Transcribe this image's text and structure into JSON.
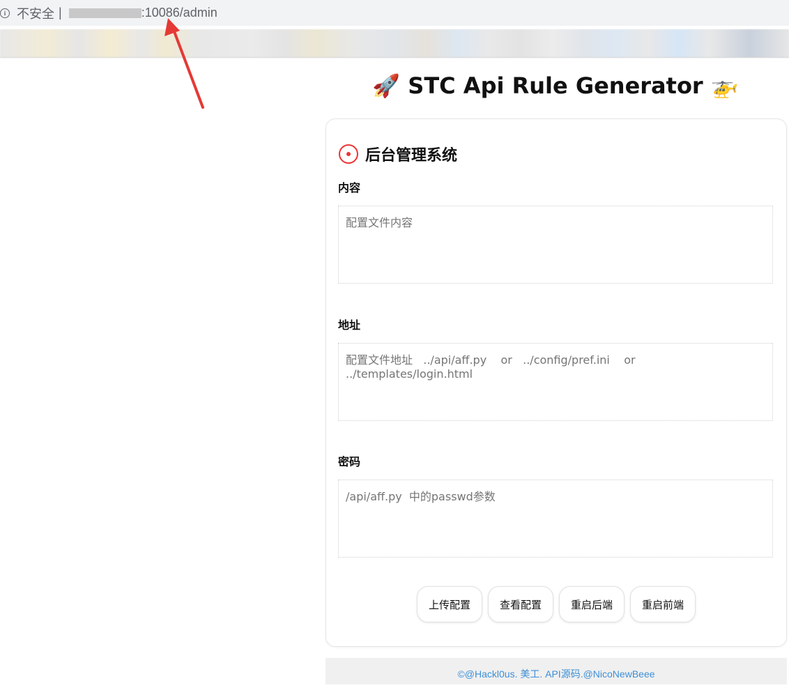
{
  "browser": {
    "security_label": "不安全",
    "separator": "|",
    "url_path": ":10086/admin"
  },
  "page": {
    "title": "🚀 STC Api Rule Generator 🚁"
  },
  "admin": {
    "title": "后台管理系统",
    "fields": [
      {
        "label": "内容",
        "placeholder": "配置文件内容"
      },
      {
        "label": "地址",
        "placeholder": "配置文件地址   ../api/aff.py    or   ../config/pref.ini    or  ../templates/login.html"
      },
      {
        "label": "密码",
        "placeholder": "/api/aff.py  中的passwd参数"
      }
    ],
    "buttons": [
      "上传配置",
      "查看配置",
      "重启后端",
      "重启前端"
    ]
  },
  "footer": {
    "text": "©@Hackl0us. 美工. API源码.@NicoNewBeee"
  },
  "colors": {
    "link": "#3d8fd6",
    "arrow": "#e53935"
  }
}
